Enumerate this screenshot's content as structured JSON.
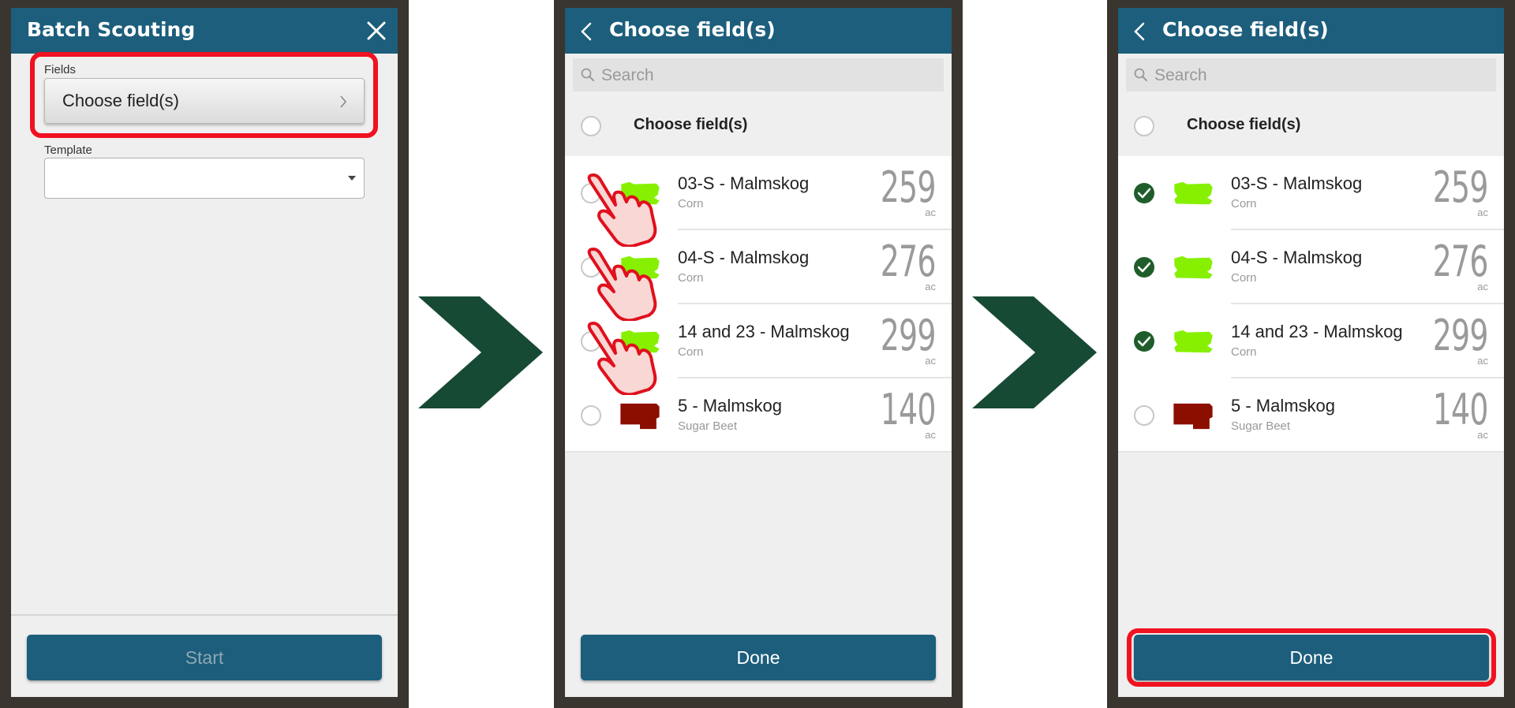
{
  "panel1": {
    "header_title": "Batch Scouting",
    "fields_label": "Fields",
    "choose_button_label": "Choose field(s)",
    "template_label": "Template",
    "template_value": "",
    "start_label": "Start"
  },
  "panel2": {
    "header_title": "Choose field(s)",
    "search_placeholder": "Search",
    "select_all_label": "Choose field(s)",
    "done_label": "Done",
    "fields": [
      {
        "name": "03-S - Malmskog",
        "crop": "Corn",
        "area": "259",
        "unit": "ac",
        "color": "#86f000",
        "checked": false
      },
      {
        "name": "04-S - Malmskog",
        "crop": "Corn",
        "area": "276",
        "unit": "ac",
        "color": "#86f000",
        "checked": false
      },
      {
        "name": "14 and 23 - Malmskog",
        "crop": "Corn",
        "area": "299",
        "unit": "ac",
        "color": "#86f000",
        "checked": false
      },
      {
        "name": "5 - Malmskog",
        "crop": "Sugar Beet",
        "area": "140",
        "unit": "ac",
        "color": "#8b0e00",
        "checked": false
      }
    ]
  },
  "panel3": {
    "header_title": "Choose field(s)",
    "search_placeholder": "Search",
    "select_all_label": "Choose field(s)",
    "done_label": "Done",
    "fields": [
      {
        "name": "03-S - Malmskog",
        "crop": "Corn",
        "area": "259",
        "unit": "ac",
        "color": "#86f000",
        "checked": true
      },
      {
        "name": "04-S - Malmskog",
        "crop": "Corn",
        "area": "276",
        "unit": "ac",
        "color": "#86f000",
        "checked": true
      },
      {
        "name": "14 and 23 - Malmskog",
        "crop": "Corn",
        "area": "299",
        "unit": "ac",
        "color": "#86f000",
        "checked": true
      },
      {
        "name": "5 - Malmskog",
        "crop": "Sugar Beet",
        "area": "140",
        "unit": "ac",
        "color": "#8b0e00",
        "checked": false
      }
    ]
  },
  "colors": {
    "header": "#1c5e7c",
    "highlight": "#f01220",
    "arrow": "#174a34",
    "check": "#1f5e2c"
  },
  "icons": [
    "close-icon",
    "back-chevron-icon",
    "search-icon",
    "chevron-right-icon",
    "check-icon",
    "hand-pointer-icon",
    "next-step-arrow-icon"
  ]
}
